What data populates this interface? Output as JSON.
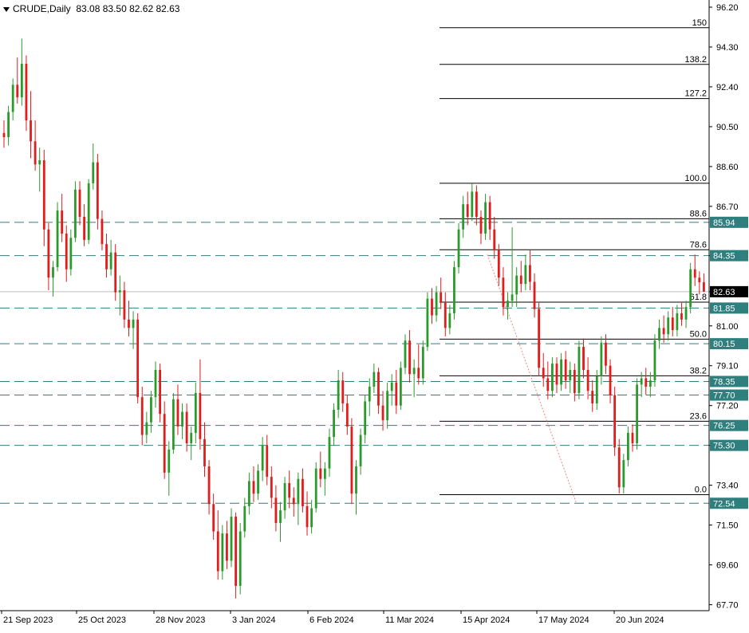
{
  "header": {
    "symbol": "CRUDE,Daily",
    "ohlc": "83.08 83.50 82.62 82.63"
  },
  "chart_data": {
    "type": "candlestick",
    "title": "CRUDE,Daily",
    "price_axis": {
      "ylim": [
        66.9,
        96.2
      ],
      "ticks": [
        "96.20",
        "94.30",
        "92.40",
        "90.50",
        "88.60",
        "86.70",
        "84.35",
        "82.63",
        "81.00",
        "79.10",
        "77.20",
        "75.30",
        "73.40",
        "71.50",
        "69.60",
        "67.70"
      ]
    },
    "time_axis": {
      "labels": [
        "21 Sep 2023",
        "25 Oct 2023",
        "28 Nov 2023",
        "3 Jan 2024",
        "6 Feb 2024",
        "11 Mar 2024",
        "15 Apr 2024",
        "17 May 2024",
        "20 Jun 2024"
      ]
    },
    "current_price": {
      "value": 82.63,
      "label": "82.63",
      "color": "#000000"
    },
    "horizontal_levels": [
      {
        "value": 85.94,
        "label": "85.94"
      },
      {
        "value": 84.35,
        "label": "84.35"
      },
      {
        "value": 81.85,
        "label": "81.85"
      },
      {
        "value": 80.15,
        "label": "80.15"
      },
      {
        "value": 78.35,
        "label": "78.35"
      },
      {
        "value": 77.7,
        "label": "77.70"
      },
      {
        "value": 76.25,
        "label": "76.25"
      },
      {
        "value": 75.3,
        "label": "75.30"
      },
      {
        "value": 72.54,
        "label": "72.54"
      }
    ],
    "fibonacci": [
      {
        "level": "150",
        "price": 95.22
      },
      {
        "level": "138.2",
        "price": 93.47
      },
      {
        "level": "127.2",
        "price": 91.84
      },
      {
        "level": "100.0",
        "price": 87.8
      },
      {
        "level": "88.6",
        "price": 86.11
      },
      {
        "level": "78.6",
        "price": 84.63
      },
      {
        "level": "61.8",
        "price": 82.13
      },
      {
        "level": "50.0",
        "price": 80.37
      },
      {
        "level": "38.2",
        "price": 78.62
      },
      {
        "level": "23.6",
        "price": 76.45
      },
      {
        "level": "0.0",
        "price": 72.95
      }
    ],
    "candles": [
      [
        90.2,
        90.8,
        89.5,
        90.0
      ],
      [
        90.0,
        91.5,
        89.6,
        91.2
      ],
      [
        91.2,
        92.8,
        90.8,
        92.5
      ],
      [
        92.5,
        93.8,
        91.6,
        91.9
      ],
      [
        91.9,
        94.7,
        91.5,
        93.5
      ],
      [
        93.5,
        93.9,
        90.3,
        90.8
      ],
      [
        90.8,
        92.2,
        89.0,
        89.8
      ],
      [
        89.8,
        90.8,
        88.4,
        88.7
      ],
      [
        88.7,
        89.5,
        87.4,
        88.9
      ],
      [
        88.9,
        89.4,
        84.8,
        85.6
      ],
      [
        85.6,
        85.9,
        82.7,
        83.3
      ],
      [
        83.3,
        84.1,
        82.4,
        83.8
      ],
      [
        83.8,
        86.9,
        83.6,
        86.5
      ],
      [
        86.5,
        87.3,
        85.0,
        85.4
      ],
      [
        85.4,
        85.8,
        83.1,
        83.7
      ],
      [
        83.7,
        85.6,
        83.4,
        85.2
      ],
      [
        85.2,
        87.9,
        85.0,
        87.5
      ],
      [
        87.5,
        87.9,
        85.8,
        86.2
      ],
      [
        86.2,
        86.8,
        84.8,
        85.1
      ],
      [
        85.1,
        88.0,
        84.9,
        87.8
      ],
      [
        87.8,
        89.7,
        87.5,
        88.8
      ],
      [
        88.8,
        89.2,
        85.6,
        86.1
      ],
      [
        86.1,
        86.5,
        84.6,
        84.9
      ],
      [
        84.9,
        85.4,
        83.3,
        83.7
      ],
      [
        83.7,
        85.1,
        83.4,
        84.5
      ],
      [
        84.5,
        84.9,
        82.2,
        82.6
      ],
      [
        82.6,
        83.4,
        81.5,
        82.7
      ],
      [
        82.7,
        83.1,
        80.9,
        81.3
      ],
      [
        81.3,
        82.2,
        80.5,
        80.9
      ],
      [
        80.9,
        81.7,
        79.9,
        81.3
      ],
      [
        81.3,
        81.6,
        77.3,
        77.6
      ],
      [
        77.6,
        78.1,
        75.3,
        75.8
      ],
      [
        75.8,
        76.9,
        75.4,
        76.4
      ],
      [
        76.4,
        77.9,
        75.9,
        77.6
      ],
      [
        77.6,
        79.3,
        77.1,
        78.9
      ],
      [
        78.9,
        79.2,
        76.4,
        76.8
      ],
      [
        76.8,
        77.4,
        73.7,
        74.0
      ],
      [
        74.0,
        75.5,
        72.9,
        75.1
      ],
      [
        75.1,
        77.8,
        74.9,
        77.5
      ],
      [
        77.5,
        78.2,
        75.8,
        76.2
      ],
      [
        76.2,
        77.3,
        75.6,
        76.9
      ],
      [
        76.9,
        77.3,
        75.0,
        75.4
      ],
      [
        75.4,
        76.2,
        74.6,
        75.9
      ],
      [
        75.9,
        78.3,
        75.4,
        77.8
      ],
      [
        77.8,
        79.4,
        75.1,
        75.6
      ],
      [
        75.6,
        76.4,
        73.8,
        74.3
      ],
      [
        74.3,
        74.6,
        72.0,
        72.5
      ],
      [
        72.5,
        73.0,
        70.8,
        71.2
      ],
      [
        71.2,
        72.2,
        68.9,
        69.3
      ],
      [
        69.3,
        71.5,
        68.9,
        71.1
      ],
      [
        71.1,
        71.7,
        69.4,
        69.8
      ],
      [
        69.8,
        72.3,
        69.5,
        71.9
      ],
      [
        71.9,
        72.1,
        68.0,
        68.6
      ],
      [
        68.6,
        71.6,
        68.2,
        71.2
      ],
      [
        71.2,
        72.8,
        70.9,
        72.4
      ],
      [
        72.4,
        74.0,
        72.0,
        73.6
      ],
      [
        73.6,
        74.3,
        72.6,
        73.0
      ],
      [
        73.0,
        74.4,
        72.7,
        74.1
      ],
      [
        74.1,
        75.7,
        73.6,
        75.3
      ],
      [
        75.3,
        75.8,
        73.4,
        73.8
      ],
      [
        73.8,
        74.3,
        72.3,
        72.8
      ],
      [
        72.8,
        73.4,
        71.2,
        71.6
      ],
      [
        71.6,
        72.6,
        70.7,
        72.2
      ],
      [
        72.2,
        73.8,
        71.8,
        73.5
      ],
      [
        73.5,
        74.1,
        72.3,
        72.8
      ],
      [
        72.8,
        73.3,
        71.9,
        72.5
      ],
      [
        72.5,
        74.0,
        71.5,
        73.7
      ],
      [
        73.7,
        74.2,
        72.1,
        72.4
      ],
      [
        72.4,
        73.1,
        71.0,
        71.4
      ],
      [
        71.4,
        72.7,
        71.1,
        72.3
      ],
      [
        72.3,
        74.5,
        72.1,
        74.2
      ],
      [
        74.2,
        75.0,
        73.3,
        73.7
      ],
      [
        73.7,
        74.5,
        72.9,
        74.2
      ],
      [
        74.2,
        76.1,
        73.8,
        75.7
      ],
      [
        75.7,
        77.3,
        75.3,
        77.0
      ],
      [
        77.0,
        78.9,
        76.6,
        78.4
      ],
      [
        78.4,
        78.8,
        76.9,
        77.3
      ],
      [
        77.3,
        77.7,
        75.8,
        76.2
      ],
      [
        76.2,
        76.6,
        72.5,
        73.0
      ],
      [
        73.0,
        74.6,
        72.0,
        74.3
      ],
      [
        74.3,
        76.1,
        73.9,
        75.8
      ],
      [
        75.8,
        77.7,
        75.4,
        77.4
      ],
      [
        77.4,
        78.5,
        76.7,
        78.1
      ],
      [
        78.1,
        79.2,
        77.8,
        78.8
      ],
      [
        78.8,
        79.0,
        76.8,
        77.2
      ],
      [
        77.2,
        77.9,
        76.0,
        76.5
      ],
      [
        76.5,
        78.3,
        76.1,
        77.9
      ],
      [
        77.9,
        78.7,
        77.2,
        78.3
      ],
      [
        78.3,
        78.9,
        76.8,
        77.2
      ],
      [
        77.2,
        79.3,
        77.0,
        79.0
      ],
      [
        79.0,
        80.6,
        78.7,
        80.3
      ],
      [
        80.3,
        80.8,
        78.3,
        78.7
      ],
      [
        78.7,
        79.4,
        77.6,
        79.0
      ],
      [
        79.0,
        80.1,
        78.2,
        78.5
      ],
      [
        78.5,
        80.3,
        78.2,
        80.0
      ],
      [
        80.0,
        82.6,
        79.8,
        82.3
      ],
      [
        82.3,
        82.8,
        81.1,
        81.5
      ],
      [
        81.5,
        82.9,
        81.2,
        82.6
      ],
      [
        82.6,
        83.3,
        81.8,
        82.1
      ],
      [
        82.1,
        82.6,
        80.5,
        80.9
      ],
      [
        80.9,
        82.0,
        80.6,
        81.6
      ],
      [
        81.6,
        84.1,
        81.3,
        83.8
      ],
      [
        83.8,
        85.9,
        83.5,
        85.6
      ],
      [
        85.6,
        87.2,
        85.2,
        86.8
      ],
      [
        86.8,
        87.4,
        85.8,
        86.2
      ],
      [
        86.2,
        87.8,
        86.0,
        87.4
      ],
      [
        87.4,
        87.7,
        85.8,
        86.2
      ],
      [
        86.2,
        86.5,
        84.9,
        85.4
      ],
      [
        85.4,
        87.3,
        85.1,
        86.9
      ],
      [
        86.9,
        87.2,
        85.1,
        85.6
      ],
      [
        85.6,
        86.2,
        84.2,
        84.6
      ],
      [
        84.6,
        84.9,
        82.9,
        83.3
      ],
      [
        83.3,
        83.8,
        81.5,
        81.9
      ],
      [
        81.9,
        82.6,
        81.3,
        82.2
      ],
      [
        82.2,
        85.7,
        81.9,
        82.5
      ],
      [
        82.5,
        83.8,
        81.9,
        83.4
      ],
      [
        83.4,
        84.1,
        82.6,
        83.0
      ],
      [
        83.0,
        84.4,
        82.7,
        83.9
      ],
      [
        83.9,
        84.6,
        82.7,
        83.1
      ],
      [
        83.1,
        83.5,
        81.4,
        81.8
      ],
      [
        81.8,
        82.1,
        78.6,
        79.0
      ],
      [
        79.0,
        79.7,
        78.1,
        78.5
      ],
      [
        78.5,
        79.3,
        77.5,
        77.9
      ],
      [
        77.9,
        79.5,
        77.6,
        79.2
      ],
      [
        79.2,
        79.5,
        77.8,
        78.2
      ],
      [
        78.2,
        79.7,
        77.9,
        79.4
      ],
      [
        79.4,
        79.8,
        78.0,
        78.4
      ],
      [
        78.4,
        79.3,
        77.8,
        78.9
      ],
      [
        78.9,
        79.2,
        77.4,
        77.8
      ],
      [
        77.8,
        80.3,
        77.5,
        80.0
      ],
      [
        80.0,
        80.4,
        78.5,
        78.9
      ],
      [
        78.9,
        79.5,
        77.5,
        77.9
      ],
      [
        77.9,
        78.4,
        76.9,
        77.3
      ],
      [
        77.3,
        78.9,
        77.0,
        78.6
      ],
      [
        78.6,
        80.5,
        78.2,
        80.2
      ],
      [
        80.2,
        80.6,
        78.7,
        79.1
      ],
      [
        79.1,
        79.4,
        77.3,
        77.7
      ],
      [
        77.7,
        78.1,
        74.8,
        75.2
      ],
      [
        75.2,
        75.6,
        73.0,
        73.3
      ],
      [
        73.3,
        74.9,
        73.0,
        74.6
      ],
      [
        74.6,
        76.2,
        74.3,
        75.9
      ],
      [
        75.9,
        76.3,
        75.0,
        75.4
      ],
      [
        75.4,
        78.5,
        75.1,
        78.2
      ],
      [
        78.2,
        78.8,
        77.6,
        78.5
      ],
      [
        78.5,
        79.0,
        77.7,
        78.1
      ],
      [
        78.1,
        78.8,
        77.6,
        78.4
      ],
      [
        78.4,
        80.6,
        78.1,
        80.3
      ],
      [
        80.3,
        81.3,
        79.9,
        80.9
      ],
      [
        80.9,
        81.5,
        80.2,
        80.6
      ],
      [
        80.6,
        81.7,
        80.3,
        81.4
      ],
      [
        81.4,
        81.9,
        80.5,
        80.8
      ],
      [
        80.8,
        82.0,
        80.5,
        81.6
      ],
      [
        81.6,
        82.1,
        81.0,
        81.3
      ],
      [
        81.3,
        82.2,
        80.9,
        81.9
      ],
      [
        81.9,
        84.0,
        81.6,
        83.7
      ],
      [
        83.7,
        84.4,
        82.9,
        83.3
      ],
      [
        83.3,
        83.6,
        82.5,
        83.08
      ],
      [
        83.08,
        83.5,
        82.62,
        82.63
      ]
    ]
  }
}
